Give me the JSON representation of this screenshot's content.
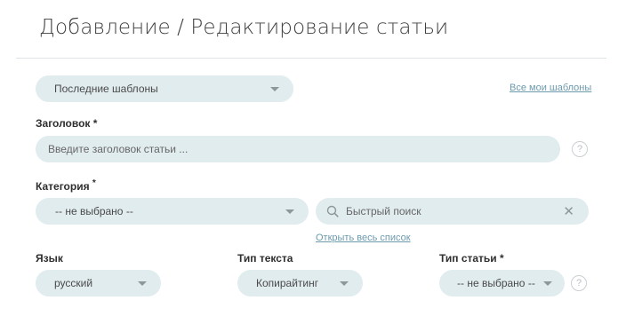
{
  "page": {
    "title": "Добавление / Редактирование статьи"
  },
  "templates": {
    "select_value": "Последние шаблоны",
    "all_link": "Все мои шаблоны"
  },
  "headline": {
    "label": "Заголовок",
    "required_mark": "*",
    "placeholder": "Введите заголовок статьи ...",
    "help_glyph": "?"
  },
  "category": {
    "label": "Категория",
    "required_mark": "*",
    "select_value": "-- не выбрано --",
    "search_placeholder": "Быстрый поиск",
    "open_list_link": "Открыть весь список"
  },
  "language": {
    "label": "Язык",
    "select_value": "русский"
  },
  "text_type": {
    "label": "Тип текста",
    "select_value": "Копирайтинг"
  },
  "article_type": {
    "label": "Тип статьи",
    "required_mark": "*",
    "select_value": "-- не выбрано --",
    "help_glyph": "?"
  },
  "icons": {
    "caret": "chevron-down-icon",
    "search": "search-icon",
    "close": "close-icon",
    "help": "question-icon"
  },
  "colors": {
    "field_background": "#e1ecef",
    "link": "#6c9aad",
    "title": "#3f3f3f"
  }
}
